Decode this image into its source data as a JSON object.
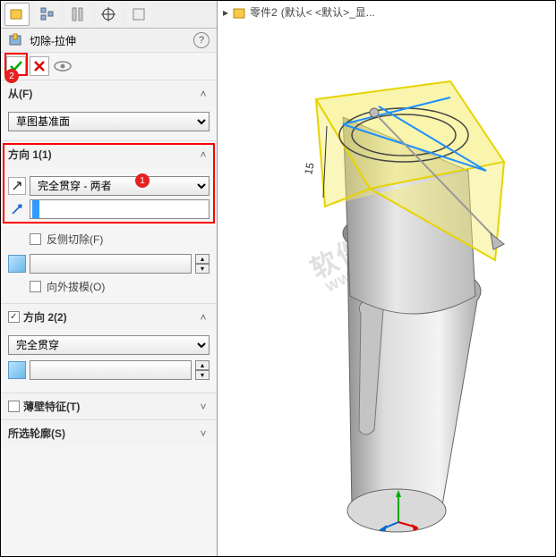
{
  "breadcrumb": {
    "part": "零件2",
    "config": "(默认< <默认>_显..."
  },
  "feature": {
    "title": "切除-拉伸"
  },
  "from": {
    "header": "从(F)",
    "plane": "草图基准面"
  },
  "dir1": {
    "header": "方向 1(1)",
    "endcond": "完全贯穿 - 两者",
    "value": "",
    "flipside": "反侧切除(F)",
    "draft": "向外拔模(O)"
  },
  "dir2": {
    "header": "方向 2(2)",
    "enabled": true,
    "endcond": "完全贯穿"
  },
  "thin": {
    "header": "薄壁特征(T)",
    "enabled": false
  },
  "contours": {
    "header": "所选轮廓(S)"
  },
  "watermark": {
    "l1": "软件自学网",
    "l2": "WWW.RJZXW.COM"
  }
}
